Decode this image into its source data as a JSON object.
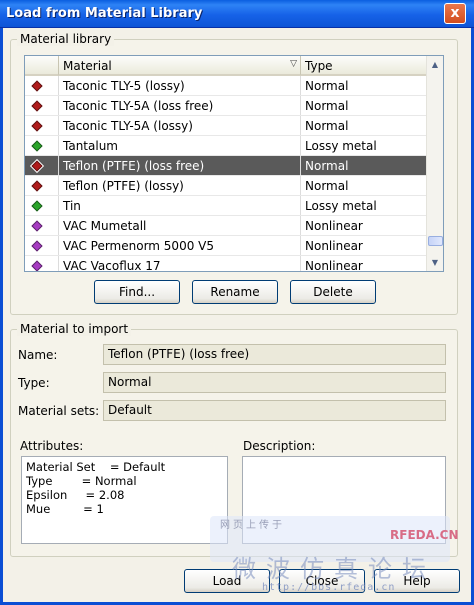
{
  "window": {
    "title": "Load from Material Library",
    "close_glyph": "x"
  },
  "library": {
    "group_title": "Material library",
    "columns": [
      "Material",
      "Type"
    ],
    "sort_indicator": "▽",
    "rows": [
      {
        "icon": "red-gem-icon",
        "color": "red",
        "name": "Taconic TLY-5 (lossy)",
        "type": "Normal"
      },
      {
        "icon": "red-gem-icon",
        "color": "red",
        "name": "Taconic TLY-5A (loss free)",
        "type": "Normal"
      },
      {
        "icon": "red-gem-icon",
        "color": "red",
        "name": "Taconic TLY-5A (lossy)",
        "type": "Normal"
      },
      {
        "icon": "green-gem-icon",
        "color": "green",
        "name": "Tantalum",
        "type": "Lossy metal"
      },
      {
        "icon": "red-gem-icon",
        "color": "red",
        "name": "Teflon (PTFE) (loss free)",
        "type": "Normal",
        "selected": true
      },
      {
        "icon": "red-gem-icon",
        "color": "red",
        "name": "Teflon (PTFE) (lossy)",
        "type": "Normal"
      },
      {
        "icon": "green-gem-icon",
        "color": "green",
        "name": "Tin",
        "type": "Lossy metal"
      },
      {
        "icon": "purple-gem-icon",
        "color": "purple",
        "name": "VAC Mumetall",
        "type": "Nonlinear"
      },
      {
        "icon": "purple-gem-icon",
        "color": "purple",
        "name": "VAC Permenorm 5000 V5",
        "type": "Nonlinear"
      },
      {
        "icon": "purple-gem-icon",
        "color": "purple",
        "name": "VAC Vacoflux 17",
        "type": "Nonlinear"
      }
    ],
    "buttons": {
      "find": "Find...",
      "rename": "Rename",
      "delete": "Delete"
    }
  },
  "import": {
    "group_title": "Material to import",
    "name_label": "Name:",
    "name_value": "Teflon (PTFE) (loss free)",
    "type_label": "Type:",
    "type_value": "Normal",
    "sets_label": "Material sets:",
    "sets_value": "Default",
    "attributes_label": "Attributes:",
    "attributes_lines": [
      "Material Set    = Default",
      "Type        = Normal",
      "Epsilon     = 2.08",
      "Mue         = 1"
    ],
    "description_label": "Description:"
  },
  "footer": {
    "load": "Load",
    "close": "Close",
    "help": "Help"
  },
  "watermark": {
    "small": "网页上传于",
    "brand": "RFEDA.CN",
    "big": "微波仿真论坛",
    "url": "http://bbs.rfeda.cn"
  },
  "colors": {
    "title_bar": "#0a5ee0",
    "selection": "#5a5a5a",
    "frame_border": "#0a4ed4"
  }
}
